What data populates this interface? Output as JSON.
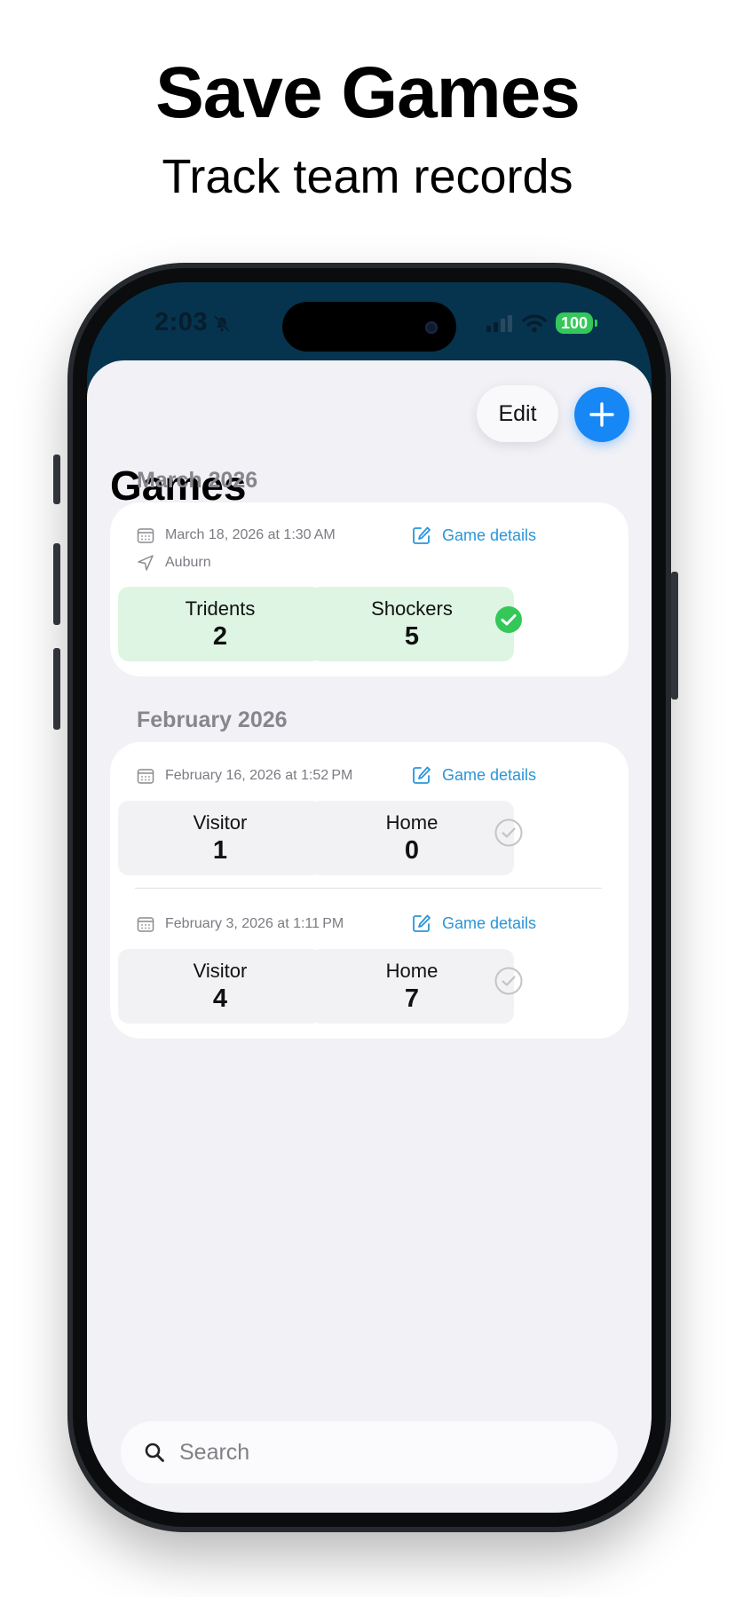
{
  "hero": {
    "title": "Save Games",
    "subtitle": "Track team records"
  },
  "status_bar": {
    "time": "2:03",
    "battery": "100"
  },
  "toolbar": {
    "edit_label": "Edit",
    "add_icon": "plus-icon"
  },
  "page_title": "Games",
  "sections": [
    {
      "header": "March 2026",
      "games": [
        {
          "datetime": "March 18, 2026 at 1:30 AM",
          "location": "Auburn",
          "details_label": "Game details",
          "away": {
            "team": "Tridents",
            "score": "2"
          },
          "home": {
            "team": "Shockers",
            "score": "5"
          },
          "status": "completed"
        }
      ]
    },
    {
      "header": "February 2026",
      "games": [
        {
          "datetime": "February 16, 2026 at 1:52 PM",
          "details_label": "Game details",
          "away": {
            "team": "Visitor",
            "score": "1"
          },
          "home": {
            "team": "Home",
            "score": "0"
          },
          "status": "pending"
        },
        {
          "datetime": "February 3, 2026 at 1:11 PM",
          "details_label": "Game details",
          "away": {
            "team": "Visitor",
            "score": "4"
          },
          "home": {
            "team": "Home",
            "score": "7"
          },
          "status": "pending"
        }
      ]
    }
  ],
  "search": {
    "placeholder": "Search"
  },
  "colors": {
    "accent": "#1787f5",
    "link": "#2a95d8",
    "win_bg": "#ddf5e2",
    "check_green": "#34c759"
  }
}
